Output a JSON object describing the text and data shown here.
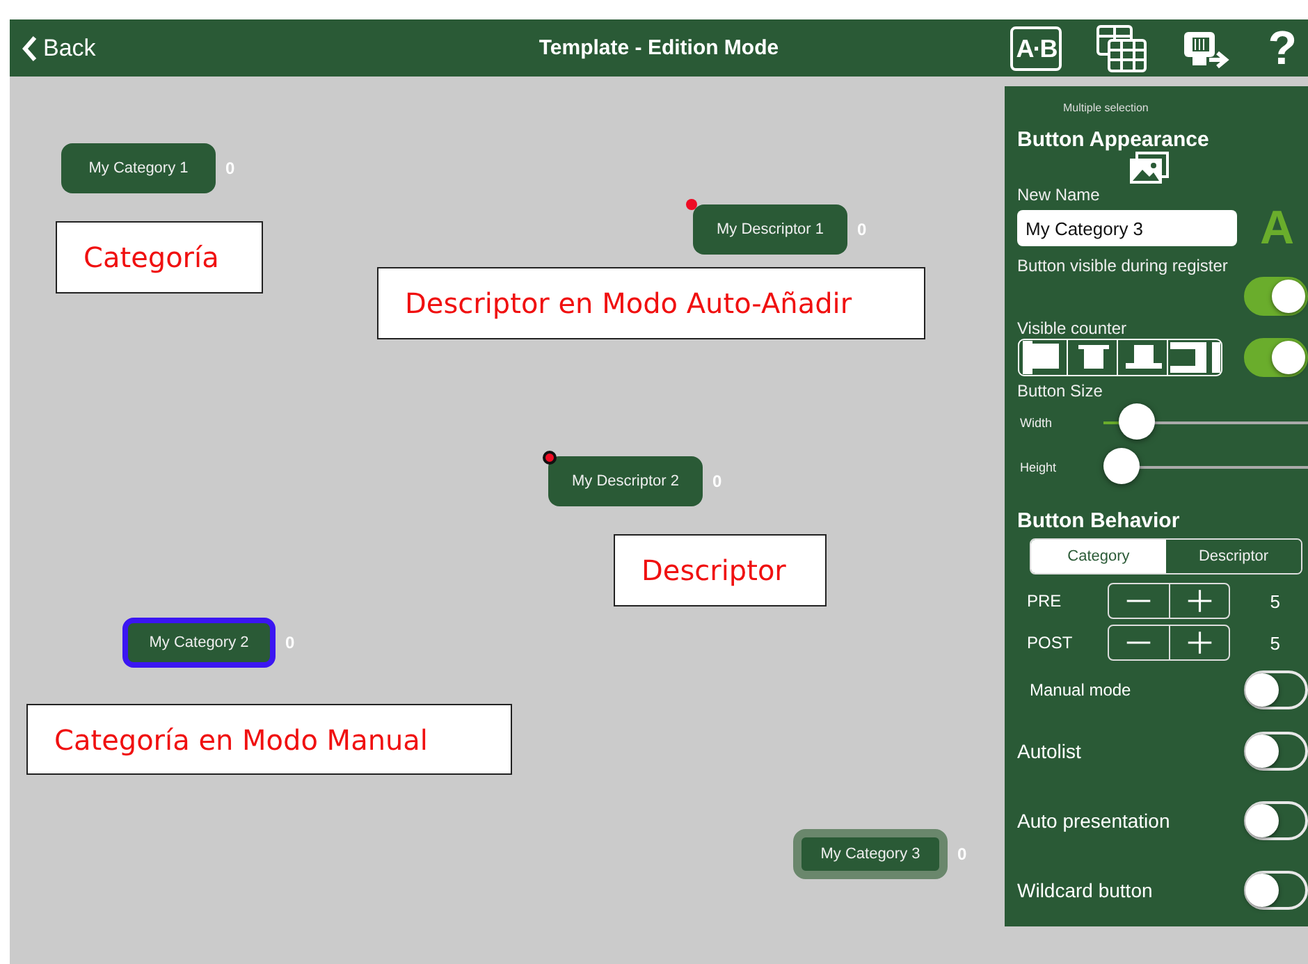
{
  "header": {
    "back": "Back",
    "title": "Template - Edition Mode",
    "ab_icon_text": "A·B",
    "help": "?"
  },
  "canvas": {
    "buttons": [
      {
        "kind": "category",
        "label": "My Category 1",
        "count": "0",
        "auto_add": false,
        "manual_mode": false,
        "selected": false
      },
      {
        "kind": "descriptor",
        "label": "My Descriptor 1",
        "count": "0",
        "auto_add": true,
        "manual_mode": false,
        "selected": false
      },
      {
        "kind": "descriptor",
        "label": "My Descriptor 2",
        "count": "0",
        "auto_add": false,
        "manual_mode": false,
        "selected": false
      },
      {
        "kind": "category",
        "label": "My Category 2",
        "count": "0",
        "auto_add": false,
        "manual_mode": true,
        "selected": false
      },
      {
        "kind": "category",
        "label": "My Category 3",
        "count": "0",
        "auto_add": false,
        "manual_mode": false,
        "selected": true
      }
    ],
    "notes": [
      "Categoría",
      "Descriptor en Modo Auto-Añadir",
      "Descriptor",
      "Categoría en Modo Manual"
    ]
  },
  "panel": {
    "multiple_selection": "Multiple selection",
    "appearance_title": "Button Appearance",
    "new_name_label": "New Name",
    "new_name_value": "My Category 3",
    "font_color_glyph": "A",
    "visible_register": {
      "label": "Button visible during register",
      "on": true
    },
    "visible_counter": {
      "label": "Visible counter",
      "on": true
    },
    "size": {
      "label": "Button Size",
      "sliders": [
        {
          "label": "Width",
          "level": 0.16
        },
        {
          "label": "Height",
          "level": 0.09
        }
      ]
    },
    "behavior": {
      "title": "Button Behavior",
      "types": [
        {
          "label": "Category",
          "selected": true
        },
        {
          "label": "Descriptor",
          "selected": false
        }
      ],
      "steppers": [
        {
          "label": "PRE",
          "value": "5"
        },
        {
          "label": "POST",
          "value": "5"
        }
      ],
      "switches": [
        {
          "kind": "sub",
          "label": "Manual mode",
          "on": false
        },
        {
          "kind": "main",
          "label": "Autolist",
          "on": false
        },
        {
          "kind": "main",
          "label": "Auto presentation",
          "on": false
        },
        {
          "kind": "main",
          "label": "Wildcard button",
          "on": false
        }
      ]
    }
  }
}
